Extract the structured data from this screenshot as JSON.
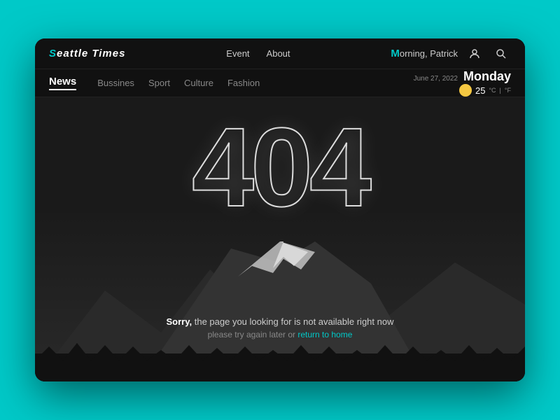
{
  "page": {
    "background_color": "#00C9C8"
  },
  "header": {
    "logo": {
      "s_letter": "S",
      "text": "eattle Times"
    },
    "nav_links": [
      {
        "label": "Event",
        "id": "event"
      },
      {
        "label": "About",
        "id": "about"
      }
    ],
    "greeting_prefix": "orning, ",
    "greeting_m": "M",
    "greeting_name": "Patrick",
    "user_icon": "👤",
    "search_icon": "🔍"
  },
  "subnav": {
    "news_label": "News",
    "links": [
      {
        "label": "Bussines"
      },
      {
        "label": "Sport"
      },
      {
        "label": "Culture"
      },
      {
        "label": "Fashion"
      }
    ],
    "date": "June 27, 2022",
    "day": "Monday",
    "temperature": "25",
    "temp_c_label": "°C",
    "temp_f_label": "°F"
  },
  "error": {
    "code": "404",
    "sorry_label": "Sorry,",
    "message": " the page you looking for is not available right now",
    "try_again": "please try again later or ",
    "return_link_label": "return to home"
  }
}
